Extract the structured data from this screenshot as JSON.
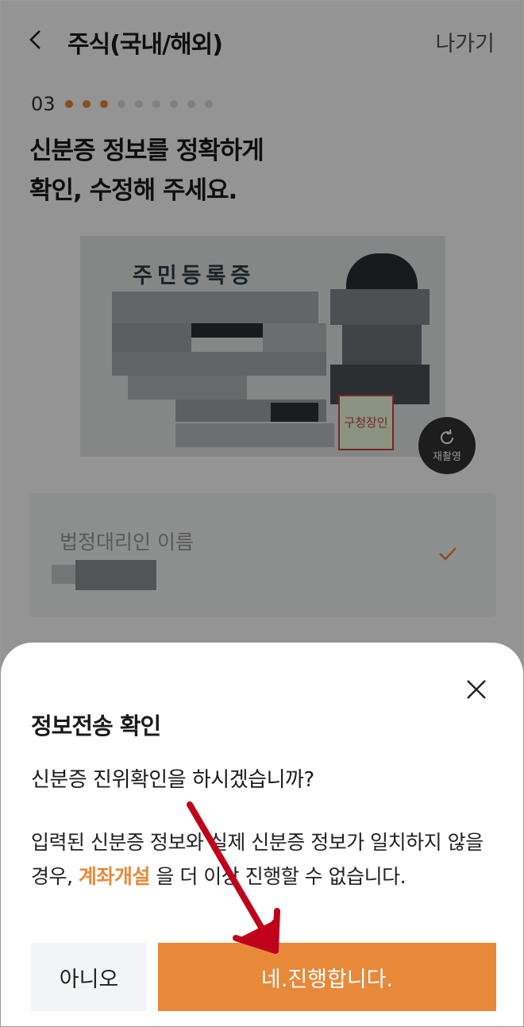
{
  "header": {
    "title": "주식(국내/해외)",
    "exit_label": "나가기"
  },
  "progress": {
    "step_label": "03",
    "total_dots": 9,
    "completed_dots": 3
  },
  "heading": {
    "line1": "신분증 정보를 정확하게",
    "line2": "확인, 수정해 주세요."
  },
  "id_card": {
    "card_title": "주민등록증",
    "seal_text": "구청장인",
    "retake_label": "재촬영"
  },
  "field": {
    "label": "법정대리인 이름",
    "check_icon": "check-icon"
  },
  "sheet": {
    "title": "정보전송 확인",
    "question": "신분증 진위확인을 하시겠습니까?",
    "desc_part1": "입력된 신분증 정보와 실제 신분증 정보가 일치하지 않을경우,",
    "desc_highlight": "계좌개설",
    "desc_part2": "을 더 이상 진행할 수 없습니다.",
    "no_label": "아니오",
    "yes_label": "네.진행합니다."
  },
  "colors": {
    "accent": "#e8893a",
    "arrow": "#c0001a",
    "overlay": "rgba(0,0,0,0.42)"
  }
}
